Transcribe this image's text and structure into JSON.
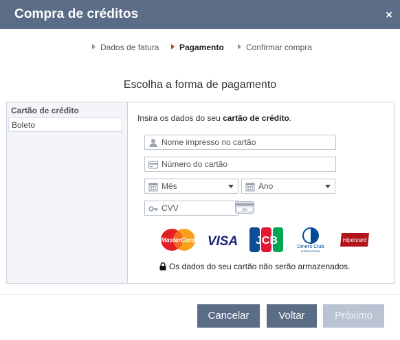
{
  "dialog": {
    "title": "Compra de créditos",
    "close_symbol": "×"
  },
  "steps": [
    {
      "label": "Dados de fatura",
      "active": false
    },
    {
      "label": "Pagamento",
      "active": true
    },
    {
      "label": "Confirmar compra",
      "active": false
    }
  ],
  "section_title": "Escolha a forma de pagamento",
  "sidebar": {
    "items": [
      {
        "label": "Cartão de crédito",
        "selected": true
      },
      {
        "label": "Boleto",
        "selected": false
      }
    ]
  },
  "form": {
    "intro_prefix": "Insira os dados do seu ",
    "intro_bold": "cartão de crédito",
    "intro_suffix": ".",
    "name_placeholder": "Nome impresso no cartão",
    "number_placeholder": "Número do cartão",
    "month_selected": "Mês",
    "year_selected": "Ano",
    "cvv_placeholder": "CVV",
    "cvv_badge_text": "xxx"
  },
  "card_brands": [
    "MasterCard",
    "VISA",
    "JCB",
    "Diners Club",
    "INTERNATIONAL",
    "Hipercard"
  ],
  "security_note": "Os dados do seu cartão não serão armazenados.",
  "buttons": {
    "cancel": "Cancelar",
    "back": "Voltar",
    "next": "Próximo",
    "next_enabled": false
  },
  "colors": {
    "header": "#5b6c86",
    "button": "#5b6c86",
    "button_disabled": "#b9c3d2",
    "active_step_arrow": "#c0392b"
  }
}
